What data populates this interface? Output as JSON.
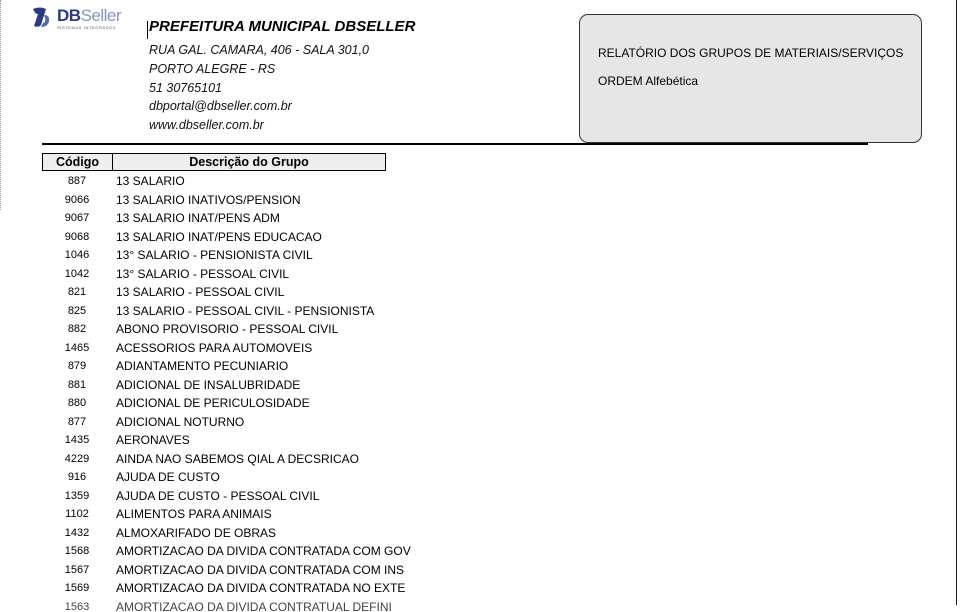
{
  "logo": {
    "brand_bold": "DB",
    "brand_light": "Seller",
    "tagline": "SISTEMAS INTEGRADOS"
  },
  "org": {
    "name": "PREFEITURA MUNICIPAL DBSELLER",
    "address": "RUA GAL. CAMARA, 406 - SALA 301,0",
    "city": "PORTO ALEGRE - RS",
    "phone": "51 30765101",
    "email": "dbportal@dbseller.com.br",
    "website": "www.dbseller.com.br"
  },
  "report": {
    "title": "RELATÓRIO DOS GRUPOS DE MATERIAIS/SERVIÇOS",
    "order": "ORDEM Alfebética"
  },
  "table": {
    "headers": {
      "code": "Código",
      "description": "Descrição do Grupo"
    },
    "rows": [
      {
        "code": "887",
        "description": "13 SALARIO"
      },
      {
        "code": "9066",
        "description": "13 SALARIO INATIVOS/PENSION"
      },
      {
        "code": "9067",
        "description": "13 SALARIO INAT/PENS ADM"
      },
      {
        "code": "9068",
        "description": "13 SALARIO INAT/PENS EDUCACAO"
      },
      {
        "code": "1046",
        "description": "13° SALARIO - PENSIONISTA CIVIL"
      },
      {
        "code": "1042",
        "description": "13° SALARIO - PESSOAL CIVIL"
      },
      {
        "code": "821",
        "description": "13 SALARIO - PESSOAL CIVIL"
      },
      {
        "code": "825",
        "description": "13 SALARIO - PESSOAL CIVIL - PENSIONISTA"
      },
      {
        "code": "882",
        "description": "ABONO PROVISORIO - PESSOAL CIVIL"
      },
      {
        "code": "1465",
        "description": "ACESSORIOS PARA AUTOMOVEIS"
      },
      {
        "code": "879",
        "description": "ADIANTAMENTO PECUNIARIO"
      },
      {
        "code": "881",
        "description": "ADICIONAL DE INSALUBRIDADE"
      },
      {
        "code": "880",
        "description": "ADICIONAL DE PERICULOSIDADE"
      },
      {
        "code": "877",
        "description": "ADICIONAL NOTURNO"
      },
      {
        "code": "1435",
        "description": "AERONAVES"
      },
      {
        "code": "4229",
        "description": "AINDA NAO SABEMOS QIAL A DECSRICAO"
      },
      {
        "code": "916",
        "description": "AJUDA DE CUSTO"
      },
      {
        "code": "1359",
        "description": "AJUDA DE CUSTO - PESSOAL CIVIL"
      },
      {
        "code": "1102",
        "description": "ALIMENTOS PARA ANIMAIS"
      },
      {
        "code": "1432",
        "description": "ALMOXARIFADO DE OBRAS"
      },
      {
        "code": "1568",
        "description": "AMORTIZACAO DA DIVIDA CONTRATADA COM GOV"
      },
      {
        "code": "1567",
        "description": "AMORTIZACAO DA DIVIDA CONTRATADA COM INS"
      },
      {
        "code": "1569",
        "description": "AMORTIZACAO DA DIVIDA CONTRATADA NO EXTE"
      }
    ],
    "partial_row": {
      "code": "1563",
      "description": "AMORTIZACAO DA DIVIDA CONTRATUAL DEFINI"
    }
  }
}
